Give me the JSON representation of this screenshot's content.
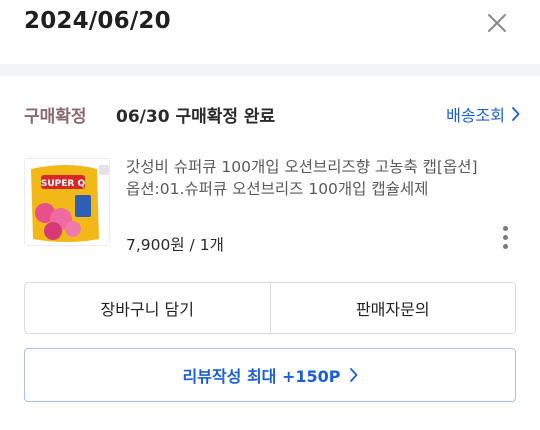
{
  "header": {
    "date": "2024/06/20"
  },
  "order": {
    "status_label": "구매확정",
    "status_text": "06/30 구매확정 완료",
    "tracking_label": "배송조회"
  },
  "product": {
    "name": "갓성비 슈퍼큐 100개입 오션브리즈향 고농축 캡[옵션] 옵션:01.슈퍼큐 오션브리즈 100개입 캡슐세제",
    "price_qty": "7,900원 / 1개",
    "thumb_brand": "SUPER Q"
  },
  "actions": {
    "cart_label": "장바구니 담기",
    "inquiry_label": "판매자문의",
    "review_label": "리뷰작성 최대 +150P"
  },
  "colors": {
    "accent_blue": "#1b5fd6",
    "status_label": "#8a6a6f"
  }
}
